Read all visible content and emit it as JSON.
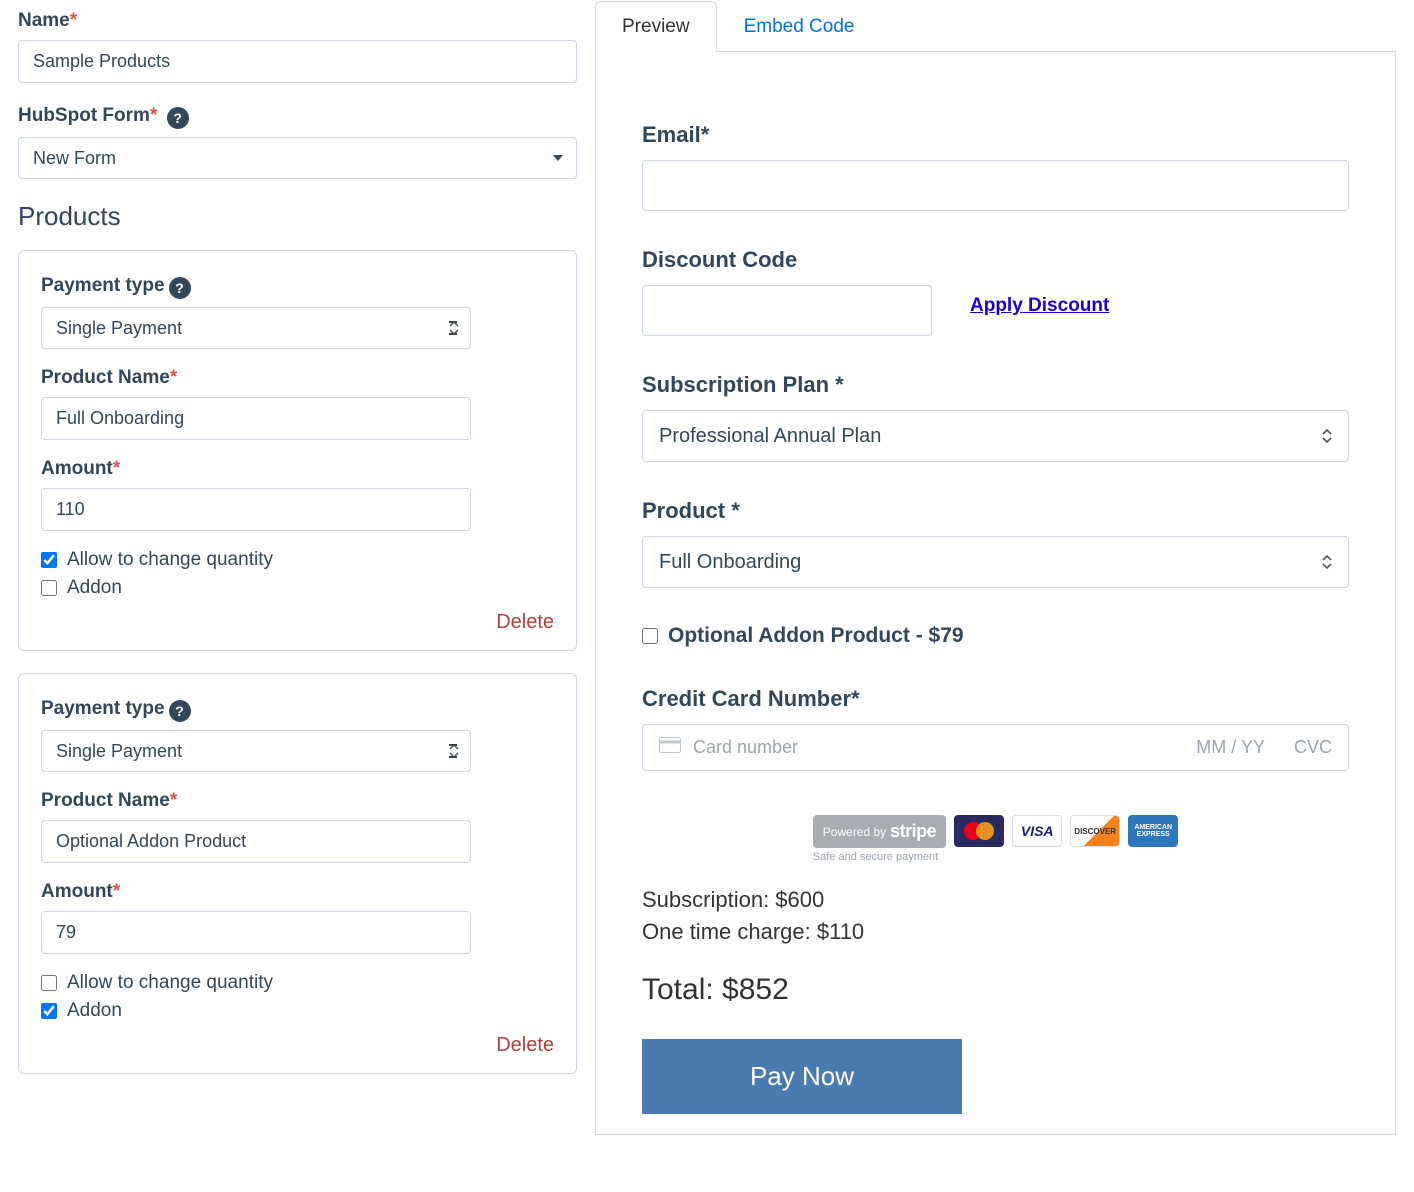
{
  "left": {
    "name_label": "Name",
    "name_value": "Sample Products",
    "hubspot_label": "HubSpot Form",
    "hubspot_value": "New Form",
    "products_heading": "Products",
    "products": [
      {
        "payment_type_label": "Payment type",
        "payment_type_value": "Single Payment",
        "product_name_label": "Product Name",
        "product_name_value": "Full Onboarding",
        "amount_label": "Amount",
        "amount_value": "110",
        "allow_qty_label": "Allow to change quantity",
        "allow_qty_checked": true,
        "addon_label": "Addon",
        "addon_checked": false,
        "delete_label": "Delete"
      },
      {
        "payment_type_label": "Payment type",
        "payment_type_value": "Single Payment",
        "product_name_label": "Product Name",
        "product_name_value": "Optional Addon Product",
        "amount_label": "Amount",
        "amount_value": "79",
        "allow_qty_label": "Allow to change quantity",
        "allow_qty_checked": false,
        "addon_label": "Addon",
        "addon_checked": true,
        "delete_label": "Delete"
      }
    ]
  },
  "tabs": {
    "preview": "Preview",
    "embed": "Embed Code"
  },
  "preview": {
    "email_label": "Email*",
    "discount_label": "Discount Code",
    "apply_discount": "Apply Discount",
    "subscription_label": "Subscription Plan *",
    "subscription_value": "Professional Annual Plan",
    "product_label": "Product *",
    "product_value": "Full Onboarding",
    "addon_label": "Optional Addon Product - $79",
    "card_label": "Credit Card Number*",
    "card_placeholder": "Card number",
    "card_expiry": "MM / YY",
    "card_cvc": "CVC",
    "stripe_powered": "Powered by",
    "stripe_name": "stripe",
    "stripe_safe": "Safe and secure payment",
    "visa": "VISA",
    "discover": "DISCOVER",
    "amex_line1": "AMERICAN",
    "amex_line2": "EXPRESS",
    "subscription_line": "Subscription: $600",
    "onetime_line": "One time charge: $110",
    "total_line": "Total: $852",
    "paynow": "Pay Now"
  }
}
